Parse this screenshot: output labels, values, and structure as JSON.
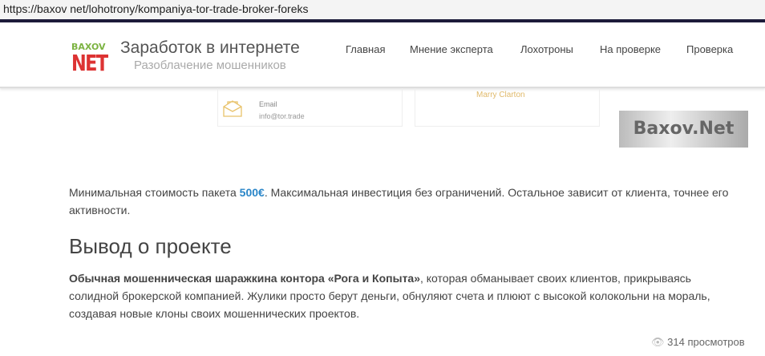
{
  "browser": {
    "url": "https://baxov net/lohotrony/kompaniya-tor-trade-broker-foreks"
  },
  "header": {
    "logo_top": "BAXOV",
    "logo_bottom": "NET",
    "title": "Заработок в интернете",
    "subtitle": "Разоблачение мошенников",
    "nav": [
      "Главная",
      "Мнение эксперта",
      "Лохотроны",
      "На проверке",
      "Проверка"
    ]
  },
  "contact": {
    "email_label": "Email",
    "email_value": "info@tor.trade",
    "name": "Marry Clarton"
  },
  "watermark": "Baxov.Net",
  "article": {
    "p1_a": "Минимальная стоимость пакета ",
    "p1_price": "500€",
    "p1_b": ". Максимальная инвестиция без ограничений. Остальное зависит от клиента, точнее его активности.",
    "heading": "Вывод о проекте",
    "p2_bold": "Обычная мошенническая шаражкина контора «Рога и Копыта»",
    "p2_rest": ", которая обманывает своих клиентов, прикрываясь солидной брокерской компанией. Жулики просто берут деньги, обнуляют счета и плюют с высокой колокольни на мораль, создавая новые клоны своих мошеннических проектов."
  },
  "views": "314 просмотров"
}
